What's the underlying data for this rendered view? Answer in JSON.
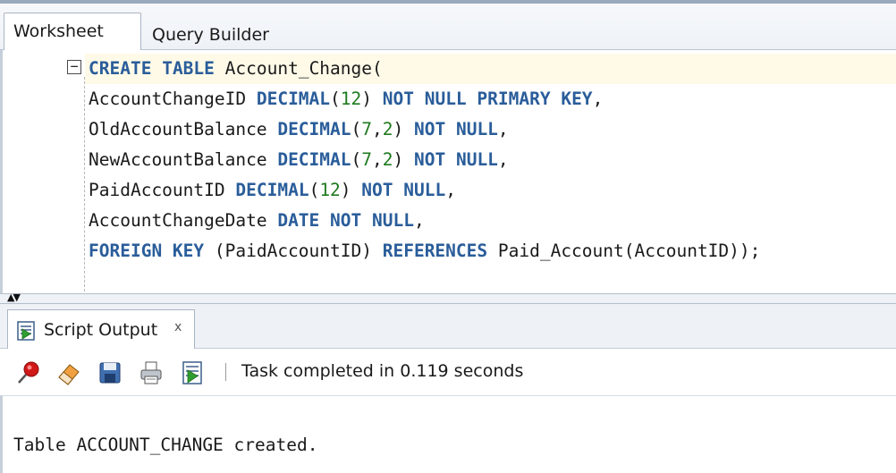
{
  "tabs": {
    "worksheet": "Worksheet",
    "query_builder": "Query Builder"
  },
  "editor": {
    "lines": [
      [
        {
          "t": "kw",
          "v": "CREATE"
        },
        {
          "t": "plain",
          "v": " "
        },
        {
          "t": "kw",
          "v": "TABLE"
        },
        {
          "t": "plain",
          "v": " Account_Change("
        }
      ],
      [
        {
          "t": "plain",
          "v": "AccountChangeID "
        },
        {
          "t": "kw",
          "v": "DECIMAL"
        },
        {
          "t": "plain",
          "v": "("
        },
        {
          "t": "num",
          "v": "12"
        },
        {
          "t": "plain",
          "v": ") "
        },
        {
          "t": "kw",
          "v": "NOT NULL PRIMARY KEY"
        },
        {
          "t": "plain",
          "v": ","
        }
      ],
      [
        {
          "t": "plain",
          "v": "OldAccountBalance "
        },
        {
          "t": "kw",
          "v": "DECIMAL"
        },
        {
          "t": "plain",
          "v": "("
        },
        {
          "t": "num",
          "v": "7"
        },
        {
          "t": "plain",
          "v": ","
        },
        {
          "t": "num",
          "v": "2"
        },
        {
          "t": "plain",
          "v": ") "
        },
        {
          "t": "kw",
          "v": "NOT NULL"
        },
        {
          "t": "plain",
          "v": ","
        }
      ],
      [
        {
          "t": "plain",
          "v": "NewAccountBalance "
        },
        {
          "t": "kw",
          "v": "DECIMAL"
        },
        {
          "t": "plain",
          "v": "("
        },
        {
          "t": "num",
          "v": "7"
        },
        {
          "t": "plain",
          "v": ","
        },
        {
          "t": "num",
          "v": "2"
        },
        {
          "t": "plain",
          "v": ") "
        },
        {
          "t": "kw",
          "v": "NOT NULL"
        },
        {
          "t": "plain",
          "v": ","
        }
      ],
      [
        {
          "t": "plain",
          "v": "PaidAccountID "
        },
        {
          "t": "kw",
          "v": "DECIMAL"
        },
        {
          "t": "plain",
          "v": "("
        },
        {
          "t": "num",
          "v": "12"
        },
        {
          "t": "plain",
          "v": ") "
        },
        {
          "t": "kw",
          "v": "NOT NULL"
        },
        {
          "t": "plain",
          "v": ","
        }
      ],
      [
        {
          "t": "plain",
          "v": "AccountChangeDate "
        },
        {
          "t": "kw",
          "v": "DATE NOT NULL"
        },
        {
          "t": "plain",
          "v": ","
        }
      ],
      [
        {
          "t": "kw",
          "v": "FOREIGN KEY"
        },
        {
          "t": "plain",
          "v": " (PaidAccountID) "
        },
        {
          "t": "kw",
          "v": "REFERENCES"
        },
        {
          "t": "plain",
          "v": " Paid_Account(AccountID));"
        }
      ]
    ]
  },
  "output_panel": {
    "tab_label": "Script Output",
    "tab_close": "x",
    "status": "Task completed in 0.119 seconds",
    "result": "Table ACCOUNT_CHANGE created."
  },
  "icons": {
    "pin": "pin-icon",
    "eraser": "eraser-icon",
    "save": "save-icon",
    "print": "print-icon",
    "script": "script-output-icon"
  },
  "colors": {
    "keyword": "#2a5d9a",
    "number": "#1f7a1f",
    "current_line": "#fffae8"
  }
}
